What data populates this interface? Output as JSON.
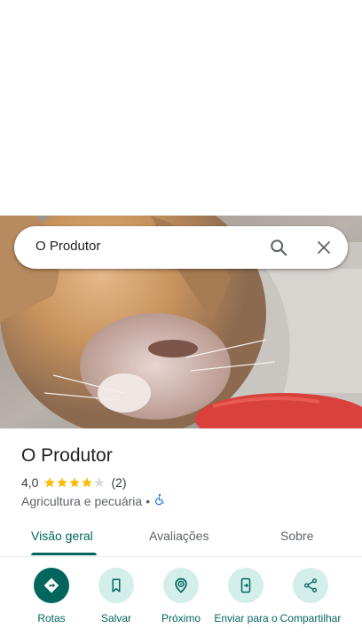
{
  "search": {
    "query": "O Produtor",
    "search_icon": "search-icon",
    "close_icon": "close-icon"
  },
  "place": {
    "name": "O Produtor",
    "rating": "4,0",
    "rating_value": 4.0,
    "review_count": "(2)",
    "category": "Agricultura e pecuária",
    "separator": "•",
    "accessibility_icon": "wheelchair-icon"
  },
  "tabs": [
    {
      "label": "Visão geral",
      "active": true
    },
    {
      "label": "Avaliações",
      "active": false
    },
    {
      "label": "Sobre",
      "active": false
    }
  ],
  "actions": [
    {
      "label": "Rotas",
      "icon": "directions-icon"
    },
    {
      "label": "Salvar",
      "icon": "bookmark-icon"
    },
    {
      "label": "Próximo",
      "icon": "nearby-icon"
    },
    {
      "label": "Enviar para o",
      "icon": "send-to-phone-icon"
    },
    {
      "label": "Compartilhar",
      "icon": "share-icon"
    }
  ],
  "colors": {
    "accent": "#00665e",
    "accent_light": "#d3eeeb",
    "star": "#fbbc04",
    "star_empty": "#dadce0",
    "accessibility": "#1a73e8"
  }
}
